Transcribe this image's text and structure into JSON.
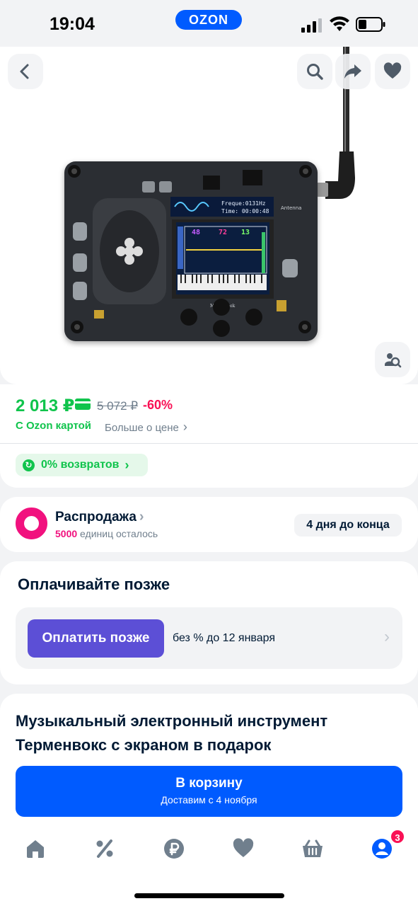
{
  "status_bar": {
    "time": "19:04",
    "brand": "OZON"
  },
  "hero": {
    "icons": [
      "back-icon",
      "search-icon",
      "share-icon",
      "heart-icon",
      "image-search-icon"
    ]
  },
  "device_screen": {
    "line1": "Freque:0131Hz",
    "line2": "Time: 00:00:48",
    "values": [
      "48",
      "72",
      "13"
    ],
    "brand": "Mixer Geek",
    "label": "Antenna"
  },
  "price": {
    "current": "2 013 ₽",
    "old": "5 072 ₽",
    "discount": "-60%",
    "card_label": "С Ozon картой",
    "more_label": "Больше о цене",
    "returns": "0% возвратов"
  },
  "sale": {
    "title": "Распродажа",
    "count": "5000",
    "units_left": "единиц осталось",
    "badge": "4 дня до конца"
  },
  "pay_later": {
    "title": "Оплачивайте позже",
    "button": "Оплатить позже",
    "info": "без % до 12 января"
  },
  "product": {
    "title": "Музыкальный электронный инструмент Терменвокс с экраном в подарок"
  },
  "cart": {
    "button": "В корзину",
    "delivery": "Доставим с 4 ноября"
  },
  "tabbar": {
    "profile_badge": "3"
  },
  "colors": {
    "accent": "#005bff",
    "green": "#10c44c",
    "pink": "#f91155",
    "purple": "#5c4fd6"
  }
}
